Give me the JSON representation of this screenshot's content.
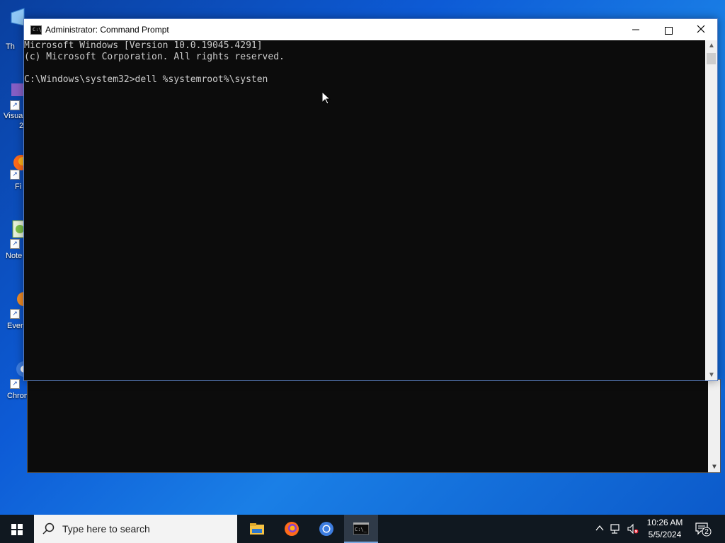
{
  "desktop_icons": [
    {
      "name": "This PC",
      "label": "Th"
    },
    {
      "name": "Visual Studio",
      "label": "Visua",
      "label2": "2"
    },
    {
      "name": "Firefox",
      "label": "Fi"
    },
    {
      "name": "Notepad++",
      "label": "Note"
    },
    {
      "name": "Everything",
      "label": "Ever"
    },
    {
      "name": "Chrome",
      "label": "Chrom"
    }
  ],
  "window": {
    "title": "Administrator: Command Prompt",
    "console_lines": [
      "Microsoft Windows [Version 10.0.19045.4291]",
      "(c) Microsoft Corporation. All rights reserved.",
      "",
      "C:\\Windows\\system32>dell %systemroot%\\systen"
    ]
  },
  "taskbar": {
    "search_placeholder": "Type here to search",
    "apps": [
      "file-explorer",
      "firefox",
      "chrome",
      "command-prompt"
    ],
    "active_app": "command-prompt"
  },
  "tray": {
    "time": "10:26 AM",
    "date": "5/5/2024",
    "notification_count": "2"
  },
  "colors": {
    "console_bg": "#0c0c0c",
    "console_text": "#cccccc",
    "taskbar_bg": "#101820"
  }
}
